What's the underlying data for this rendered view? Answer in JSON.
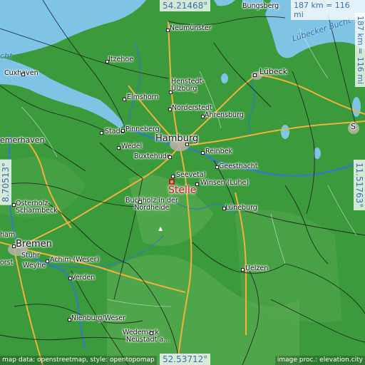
{
  "coordinates": {
    "top": "54.21468°",
    "bottom": "52.53712°",
    "left": "8.70513°",
    "right": "11.51763°"
  },
  "scale": {
    "horizontal": "187 km = 116 mi",
    "vertical": "187 km = 116 mi"
  },
  "focus_city": "Stelle",
  "cities": {
    "hamburg": "Hamburg",
    "bremen": "Bremen",
    "lubeck": "Lübeck",
    "bremerhaven": "emerhaven",
    "cuxhaven": "Cuxhaven",
    "neumunster": "Neumünster",
    "itzehoe": "Itzehoe",
    "elmshorn": "Elmshorn",
    "henstedt": "Henstedt-\nUlzburg",
    "norderstedt": "Norderstedt",
    "ahrensburg": "Ahrensburg",
    "pinneberg": "Pinneberg",
    "stade": "Stade",
    "wedel": "Wedel",
    "buxtehude": "Buxtehude",
    "reinbek": "Reinbek",
    "geesthacht": "Geesthacht",
    "seevetal": "Seevetal",
    "winsen": "Winsen (Luhe)",
    "buchholz": "Buchholz in der\nNordheide",
    "luneburg": "Lüneburg",
    "osterholz": "Osterholz-\nScharmbeck",
    "achim": "Achim (Weser)",
    "stuhr": "Stuhr",
    "weyhe": "Weyhe",
    "verden": "Verden",
    "uelzen": "Uelzen",
    "nienburg": "Nienburg/Weser",
    "wedemark": "Wedemark",
    "neustadt": "Neustadt a...",
    "bungsberg": "Bungsberg",
    "ham": "ham",
    "delmenhorst": "orst",
    "schwerin": "S"
  },
  "water_labels": {
    "lubecker_bucht": "Lübecker Bucht",
    "bucht": "cht"
  },
  "footer": {
    "left": "map data: openstreetmap, style: opentopomap",
    "right": "image proc.: elevation.city"
  },
  "colors": {
    "land": "#3c9a3c",
    "water": "#7fc4e4",
    "roads": "#f0b23a",
    "rivers": "#2e7dc4",
    "marker": "#d0121b"
  }
}
